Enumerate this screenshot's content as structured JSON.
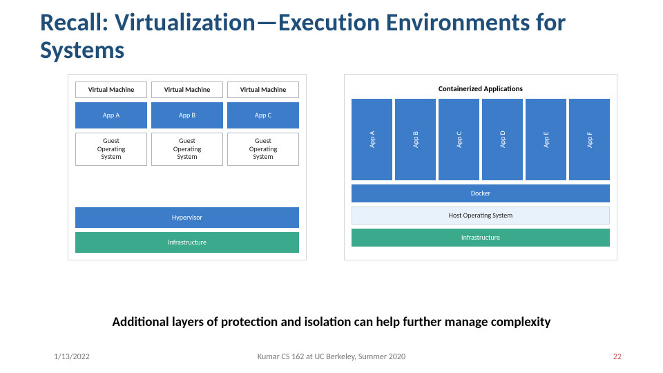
{
  "title": "Recall: Virtualization—Execution Environments for Systems",
  "vm_diagram": {
    "columns": [
      {
        "header": "Virtual Machine",
        "app": "App A",
        "guest_os": "Guest\nOperating\nSystem"
      },
      {
        "header": "Virtual Machine",
        "app": "App B",
        "guest_os": "Guest\nOperating\nSystem"
      },
      {
        "header": "Virtual Machine",
        "app": "App C",
        "guest_os": "Guest\nOperating\nSystem"
      }
    ],
    "hypervisor": "Hypervisor",
    "infrastructure": "Infrastructure"
  },
  "container_diagram": {
    "title": "Containerized Applications",
    "apps": [
      "App A",
      "App B",
      "App C",
      "App D",
      "App E",
      "App F"
    ],
    "docker": "Docker",
    "host_os": "Host Operating System",
    "infrastructure": "Infrastructure"
  },
  "caption": "Additional layers of protection and isolation can help further manage complexity",
  "footer": {
    "date": "1/13/2022",
    "center": "Kumar CS 162 at UC Berkeley, Summer 2020",
    "page": "22"
  }
}
